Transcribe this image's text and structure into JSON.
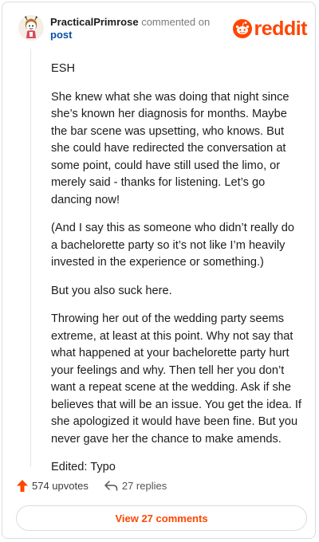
{
  "header": {
    "username": "PracticalPrimrose",
    "commented_on": "commented on",
    "post_link": "post",
    "brand": "reddit"
  },
  "comment": {
    "paragraphs": [
      "ESH",
      "She knew what she was doing that night since she’s known her diagnosis for months. Maybe the bar scene was upsetting, who knows. But she could have redirected the conversation at some point, could have still used the limo, or merely said - thanks for listening. Let’s go dancing now!",
      "(And I say this as someone who didn’t really do a bachelorette party so it’s not like I’m heavily invested in the experience or something.)",
      "But you also suck here.",
      "Throwing her out of the wedding party seems extreme, at least at this point. Why not say that what happened at your bachelorette party hurt your feelings and why. Then tell her you don’t want a repeat scene at the wedding. Ask if she believes that will be an issue. You get the idea. If she apologized it would have been fine. But you never gave her the chance to make amends.",
      "Edited: Typo"
    ]
  },
  "actions": {
    "upvotes": "574 upvotes",
    "replies": "27 replies"
  },
  "footer": {
    "view_comments": "View 27 comments"
  },
  "colors": {
    "brand": "#ff4500",
    "link": "#0a4fa3"
  },
  "icons": [
    "avatar",
    "reddit-logo-icon",
    "upvote-arrow-icon",
    "reply-icon"
  ]
}
